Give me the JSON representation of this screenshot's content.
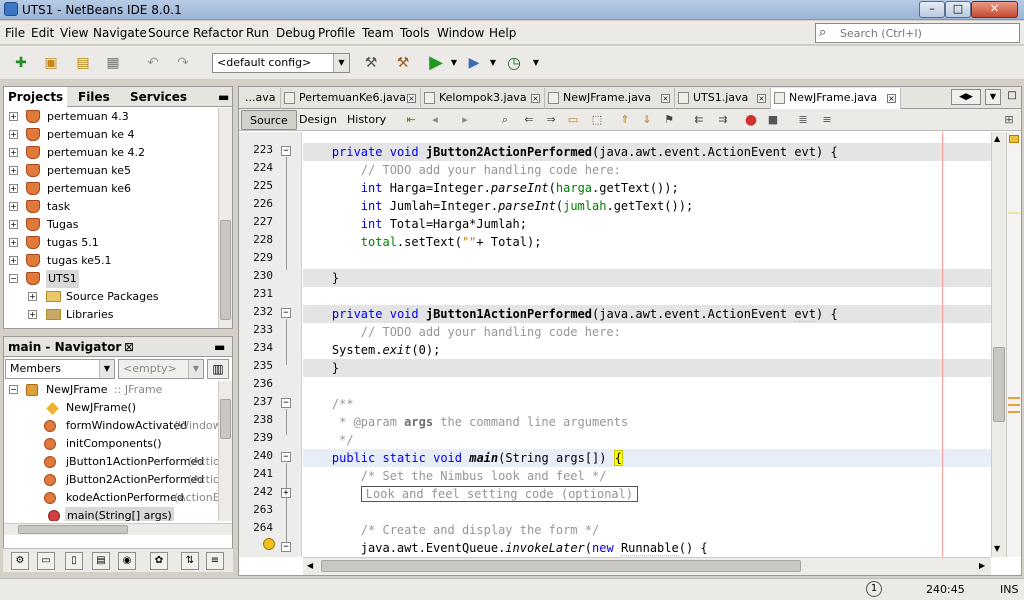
{
  "window": {
    "title": "UTS1 - NetBeans IDE 8.0.1",
    "minimize": "–",
    "maximize": "□",
    "close": "✕"
  },
  "menu": [
    "File",
    "Edit",
    "View",
    "Navigate",
    "Source",
    "Refactor",
    "Run",
    "Debug",
    "Profile",
    "Team",
    "Tools",
    "Window",
    "Help"
  ],
  "search": {
    "placeholder": "Search (Ctrl+I)"
  },
  "toolbar": {
    "config": "<default config>"
  },
  "projects": {
    "tabs": [
      "Projects",
      "Files",
      "Services"
    ],
    "items": [
      {
        "label": "pertemuan 4.3",
        "type": "project"
      },
      {
        "label": "pertemuan ke 4",
        "type": "project"
      },
      {
        "label": "pertemuan ke 4.2",
        "type": "project"
      },
      {
        "label": "pertemuan ke5",
        "type": "project"
      },
      {
        "label": "pertemuan ke6",
        "type": "project"
      },
      {
        "label": "task",
        "type": "project"
      },
      {
        "label": "Tugas",
        "type": "project"
      },
      {
        "label": "tugas 5.1",
        "type": "project"
      },
      {
        "label": "tugas ke5.1",
        "type": "project"
      },
      {
        "label": "UTS1",
        "type": "project-open"
      },
      {
        "label": "Source Packages",
        "type": "folder"
      },
      {
        "label": "Libraries",
        "type": "folder"
      }
    ]
  },
  "navigator": {
    "title": "main - Navigator",
    "filter": "Members",
    "empty": "<empty>",
    "root_name": "NewJFrame",
    "root_type": ":: JFrame",
    "members": [
      {
        "name": "NewJFrame()",
        "param": ""
      },
      {
        "name": "formWindowActivated",
        "param": "(WindowE"
      },
      {
        "name": "initComponents()",
        "param": ""
      },
      {
        "name": "jButton1ActionPerformed",
        "param": "(Actio"
      },
      {
        "name": "jButton2ActionPerformed",
        "param": "(Actio"
      },
      {
        "name": "kodeActionPerformed",
        "param": "(ActionEv"
      },
      {
        "name": "main(String[] args)",
        "param": ""
      }
    ]
  },
  "editor": {
    "tabs": [
      "...ava",
      "PertemuanKe6.java",
      "Kelompok3.java",
      "NewJFrame.java",
      "UTS1.java",
      "NewJFrame.java"
    ],
    "view_tabs": [
      "Source",
      "Design",
      "History"
    ],
    "line_numbers": [
      "223",
      "224",
      "225",
      "226",
      "227",
      "228",
      "229",
      "230",
      "231",
      "232",
      "233",
      "234",
      "235",
      "236",
      "237",
      "238",
      "239",
      "240",
      "241",
      "242",
      "263",
      "264"
    ]
  },
  "status": {
    "position": "240:45",
    "mode": "INS",
    "notify": "1"
  }
}
